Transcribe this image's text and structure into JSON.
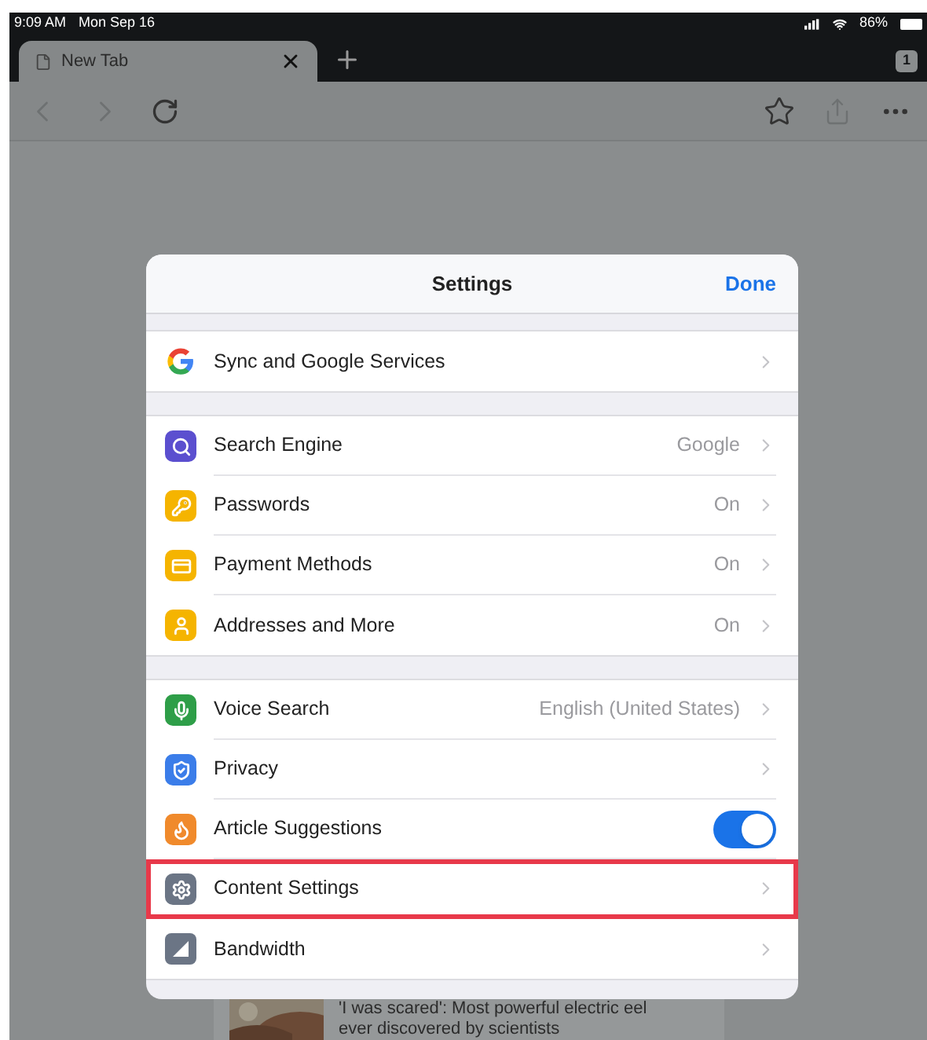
{
  "status_bar": {
    "time": "9:09 AM",
    "date": "Mon Sep 16",
    "battery": "86%"
  },
  "tabs": [
    {
      "title": "New Tab",
      "selected": true
    }
  ],
  "tab_count": "1",
  "article": {
    "headline": "'I was scared': Most powerful electric eel",
    "headline_2": "ever discovered by scientists"
  },
  "dialog": {
    "title": "Settings",
    "done": "Done",
    "sections": [
      [
        {
          "kind": "nav",
          "label": "Sync and Google Services",
          "highlighted": false
        }
      ],
      [
        {
          "kind": "nav",
          "label": "Search Engine",
          "value": "Google",
          "highlighted": false
        },
        {
          "kind": "nav",
          "label": "Passwords",
          "value": "On",
          "highlighted": false
        },
        {
          "kind": "nav",
          "label": "Payment Methods",
          "value": "On",
          "highlighted": false
        },
        {
          "kind": "nav",
          "label": "Addresses and More",
          "value": "On",
          "highlighted": false
        }
      ],
      [
        {
          "kind": "nav",
          "label": "Voice Search",
          "value": "English (United States)",
          "highlighted": false
        },
        {
          "kind": "nav",
          "label": "Privacy",
          "highlighted": false
        },
        {
          "kind": "toggle",
          "label": "Article Suggestions",
          "on": true,
          "highlighted": false
        },
        {
          "kind": "nav",
          "label": "Content Settings",
          "highlighted": true
        },
        {
          "kind": "nav",
          "label": "Bandwidth",
          "highlighted": false
        }
      ]
    ]
  }
}
